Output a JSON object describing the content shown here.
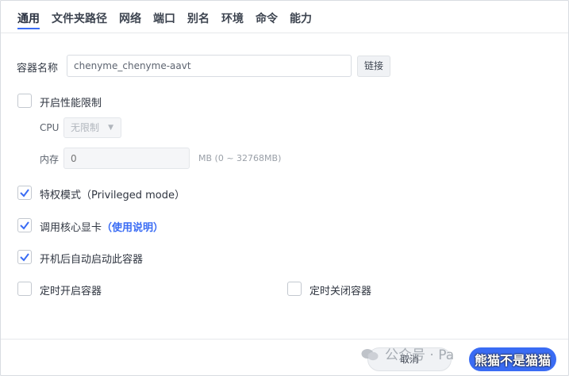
{
  "tabs": [
    "通用",
    "文件夹路径",
    "网络",
    "端口",
    "别名",
    "环境",
    "命令",
    "能力"
  ],
  "container_name": {
    "label": "容器名称",
    "value": "chenyme_chenyme-aavt",
    "link_button": "链接"
  },
  "perf_limit": {
    "label": "开启性能限制",
    "checked": false,
    "cpu_label": "CPU",
    "cpu_value": "无限制",
    "mem_label": "内存",
    "mem_placeholder": "0",
    "mem_hint": "MB (0 ~ 32768MB)"
  },
  "privileged": {
    "label": "特权模式（Privileged mode）",
    "checked": true
  },
  "gpu": {
    "label": "调用核心显卡",
    "link": "（使用说明）",
    "checked": true
  },
  "autostart": {
    "label": "开机后自动启动此容器",
    "checked": true
  },
  "timer_on": {
    "label": "定时开启容器",
    "checked": false
  },
  "timer_off": {
    "label": "定时关闭容器",
    "checked": false
  },
  "footer": {
    "cancel": "取消",
    "watermark": "公众号 · Pa",
    "watermark_overlay": "熊猫不是猫猫"
  },
  "colors": {
    "accent": "#3a6cf4",
    "check": "#3a6cf4"
  }
}
